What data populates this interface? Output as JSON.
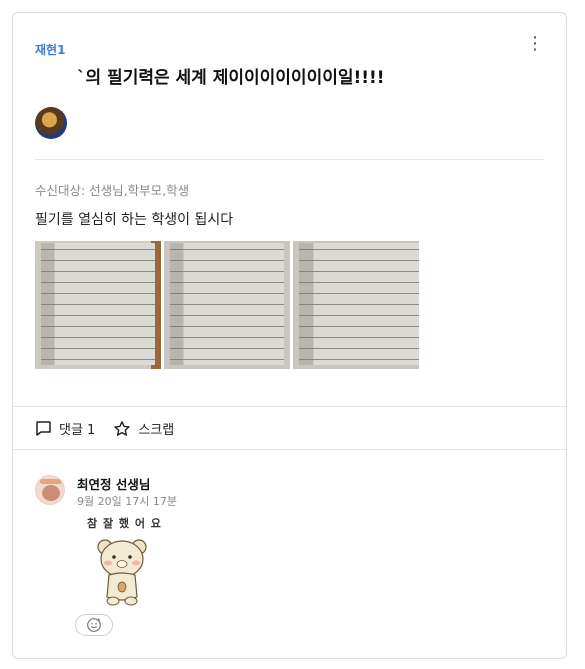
{
  "post": {
    "author": "재현1",
    "title": "`의 필기력은 세계 제이이이이이이이일!!!!",
    "recipients": "수신대상: 선생님,학부모,학생",
    "body": "필기를 열심히 하는 학생이 됩시다",
    "photos": [
      "handwritten-notes-photo-1",
      "handwritten-notes-photo-2",
      "handwritten-notes-photo-3"
    ],
    "more_icon": "⋮"
  },
  "actions": {
    "comment_label": "댓글 1",
    "scrap_label": "스크랩"
  },
  "comment": {
    "author": "최연정 선생님",
    "time": "9월 20일 17시 17분",
    "sticker_text": "참 잘 했 어 요"
  },
  "colors": {
    "accent": "#3b7be0",
    "muted": "#8a8a8a",
    "border": "#dcdcdc"
  }
}
